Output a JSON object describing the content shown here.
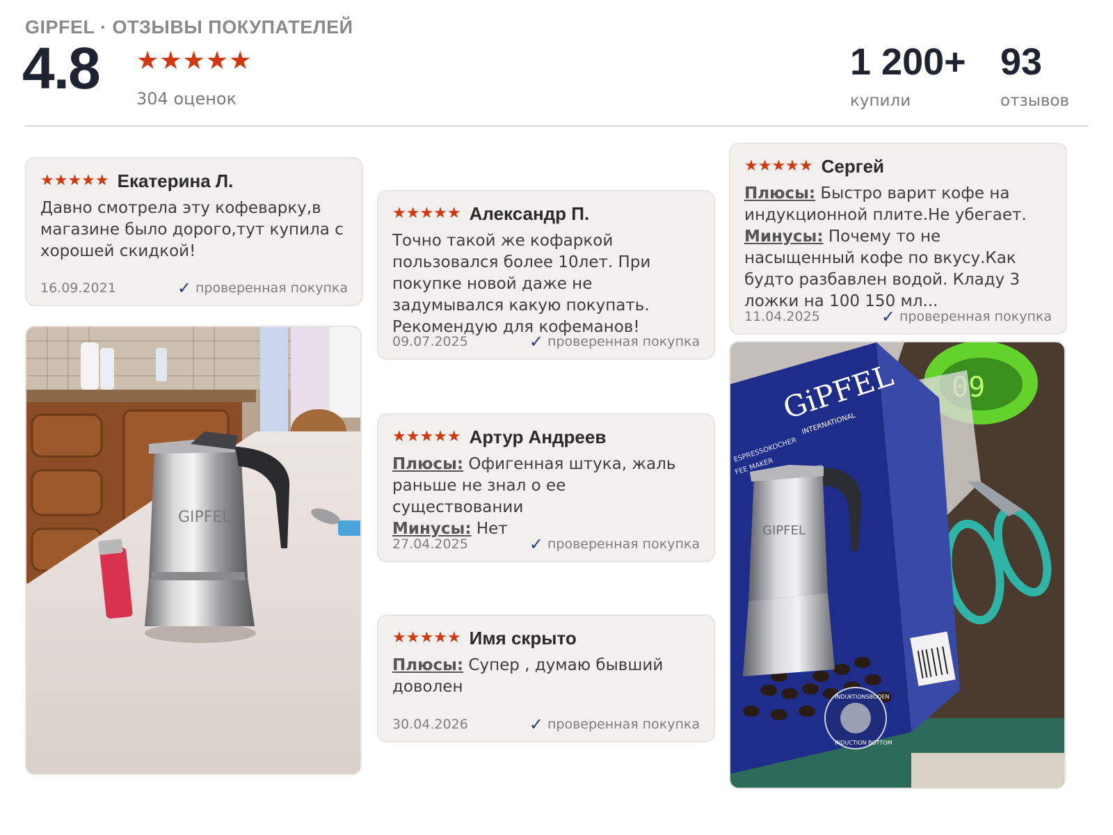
{
  "header": {
    "brand_line": "GIPFEL · ОТЗЫВЫ ПОКУПАТЕЛЕЙ",
    "rating": "4.8",
    "rating_stars": "★★★★★",
    "ratings_count": "304 оценок",
    "stats": [
      {
        "value": "1 200+",
        "label": "купили"
      },
      {
        "value": "93",
        "label": "отзывов"
      }
    ]
  },
  "colors": {
    "star": "#d2380f",
    "check": "#263a7e",
    "card_bg": "#f1f0ee",
    "text_dark": "#1f2230"
  },
  "reviews": [
    {
      "stars": "★★★★★",
      "rating": 5,
      "author": "Екатерина Л.",
      "text": "Давно смотрела эту кофеварку,в магазине было дорого,тут купила с хорошей скидкой!",
      "date": "16.09.2021",
      "verified": "проверенная покупка"
    },
    {
      "stars": "★★★★★",
      "rating": 5,
      "author": "Александр П.",
      "text": "Точно такой же кофаркой пользовался более 10лет. При покупке новой даже не задумывался какую покупать. Рекомендую для кофеманов!",
      "date": "09.07.2025",
      "verified": "проверенная покупка"
    },
    {
      "stars": "★★★★★",
      "rating": 5,
      "author": "Артур Андреев",
      "pros_label": "Плюсы:",
      "pros": "Офигенная штука, жаль раньше не знал о ее существовании",
      "cons_label": "Минусы:",
      "cons": "Нет",
      "date": "27.04.2025",
      "verified": "проверенная покупка"
    },
    {
      "stars": "★★★★★",
      "rating": 5,
      "author": "Имя скрыто",
      "pros_label": "Плюсы:",
      "pros": "Супер , думаю бывший доволен",
      "date": "30.04.2026",
      "verified": "проверенная покупка"
    },
    {
      "stars": "★★★★★",
      "rating": 5,
      "author": "Сергей",
      "pros_label": "Плюсы:",
      "pros": "Быстро варит кофе на индукционной плите.Не убегает.",
      "cons_label": "Минусы:",
      "cons": "Почему то не насыщенный кофе по вкусу.Как будто разбавлен водой. Кладу 3 ложки на 100 150 мл...",
      "date": "11.04.2025",
      "verified": "проверенная покупка"
    }
  ],
  "photos": {
    "box_brand": "GiPFEL",
    "box_sub": "INTERNATIONAL",
    "box_logo": "GIPFEL",
    "clock_text": "09",
    "box_side_text": "ESPRESSOKOCHER",
    "box_side_text2": "FEE MAKER",
    "box_bottom_text": "INDUKTIONSBODEN",
    "box_bottom_text2": "INDUCTION BOTTOM",
    "pot_logo": "GIPFEL"
  }
}
